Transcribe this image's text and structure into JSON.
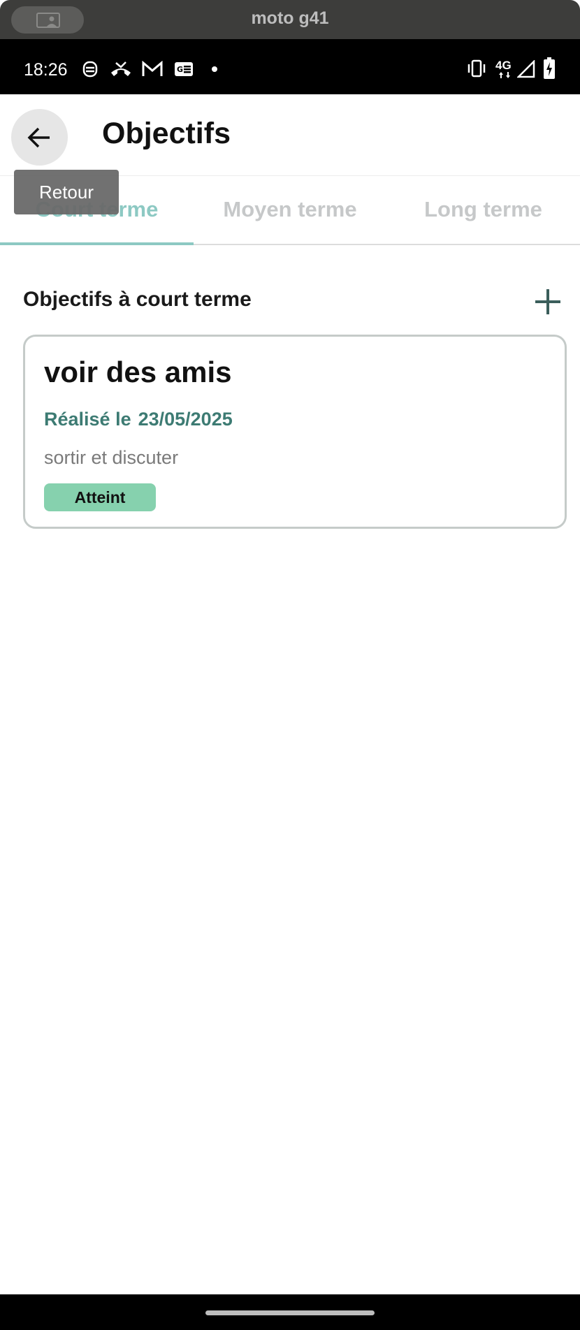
{
  "window": {
    "title": "moto g41"
  },
  "status_bar": {
    "time": "18:26",
    "left_icons": [
      "notification-app-icon",
      "missed-call-icon",
      "gmail-icon",
      "news-icon",
      "more-dot-icon"
    ],
    "right_icons": [
      "vibrate-icon",
      "network-4g-icon",
      "signal-icon",
      "battery-charging-icon"
    ],
    "network_label": "4G"
  },
  "app_bar": {
    "title": "Objectifs",
    "back_tooltip": "Retour"
  },
  "tabs": [
    {
      "label": "Court terme",
      "active": true
    },
    {
      "label": "Moyen terme",
      "active": false
    },
    {
      "label": "Long terme",
      "active": false
    }
  ],
  "section": {
    "title": "Objectifs à court terme"
  },
  "goals": [
    {
      "title": "voir des amis",
      "date_label": "Réalisé le",
      "date": "23/05/2025",
      "description": "sortir et discuter",
      "status": "Atteint"
    }
  ],
  "colors": {
    "accent": "#8dc9c3",
    "date_text": "#3d7b73",
    "badge_bg": "#86d1ae",
    "card_border": "#c5cbc9"
  }
}
